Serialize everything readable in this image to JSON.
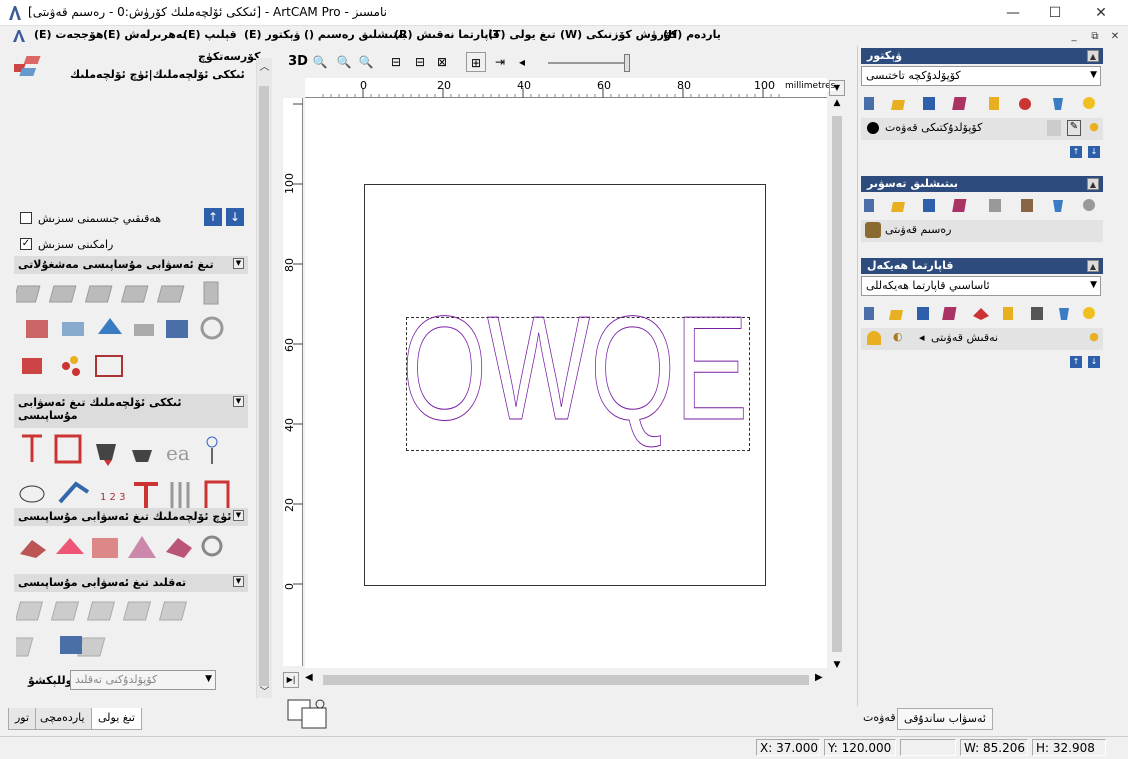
{
  "window": {
    "title": "[ﺋﯩﻜﻜﻰ ﺋﯚﻟﭽﻪﻣﻠﯩﻚ ﻛﯚﺭﯛﺵ:0 - ﺭﻩﺳﯩﻢ ﻗﻪﯞﯨﺘﻰ] - ArtCAM Pro - ﻧﺎﻣﺴﯩﺰ",
    "minimize": "—",
    "maximize": "☐",
    "close": "✕"
  },
  "menu": {
    "items": [
      "(H) ﻳﺎﺭﺩﻩﻡ",
      "(W) ﻛﯚﺭﯛﺵ ﻛﯚﺯﻧﯩﻜﻰ",
      "(T) ﺗﯩﻎ ﻳﻮﻟﻰ",
      "(R) ﻗﺎﭘﺎﺭﺗﻤﺎ ﻧﻪﻗﯩﺶ",
      "() ﺑﯩﺘﯩﺸﻠﯩﻖ ﺭﻩﺳﯩﻢ",
      "(E) ﯞﯦﻜﺘﻮﺭ",
      "(E) ﻗﯧﻠﯩﭗ",
      "(E) ﺗﻪﮬﺮﯨﺮﻟﻪﺵ",
      "(E) ﮬﯚﺟﺠﻪﺕ"
    ],
    "mdi": [
      "_",
      "⧉",
      "✕"
    ]
  },
  "left": {
    "header_title": "ﻛﯚﺭﺳﻪﺗﻜﯜﭺ",
    "header_sub": "ﺋﯩﻜﻜﻰ ﺋﯚﻟﭽﻪﻣﻠﯩﻚ|ﺋﯜﭺ ﺋﯚﻟﭽﻪﻣﻠﯩﻚ",
    "check1_label": "ﮬﻪﻗﯩﻘﯩﻲ ﺟﯩﺴﯩﻤﻨﻰ ﺳﯩﺰﯨﺶ",
    "check2_label": "ﺭﺍﻣﻜﯩﻨﻰ ﺳﯩﺰﯨﺶ",
    "sections": [
      "ﺗﯩﻎ ﺋﻪﺳﯟﺍﺑﻰ ﻣﯘﺳﺎﭘﯩﺴﻰ ﻣﻪﺷﻐﯘﻻﺗﻰ",
      "ﺋﯩﻜﻜﻰ ﺋﯚﻟﭽﻪﻣﻠﯩﻚ ﺗﯩﻎ ﺋﻪﺳﯟﺍﺑﻰ ﻣﯘﺳﺎﭘﯩﺴﻰ",
      "ﺋﯜﭺ ﺋﯚﻟﭽﻪﻣﻠﯩﻚ ﺗﯩﻎ ﺋﻪﺳﯟﺍﺑﻰ ﻣﯘﺳﺎﭘﯩﺴﻰ",
      "ﺗﻪﻗﻠﯩﺪ ﺗﯩﻎ ﺋﻪﺳﯟﺍﺑﻰ ﻣﯘﺳﺎﭘﯩﺴﻰ"
    ],
    "collection_label": "ﻛﻮﻟﻠﯧﻜﺸﯘ",
    "collection_value": "ﻛﯚﭘﯚﻟﺪﯗﻛﻨﻰ ﺗﻪﻗﻠﯩﺪ",
    "tabs": [
      "ﺗﯩﻎ ﻳﻮﻟﻰ",
      "ﻳﺎﺭﺩﻩﻣﭽﻰ",
      "ﺗﻮﺭ"
    ]
  },
  "view": {
    "btn3d": "3D",
    "ruler_unit": "millimetres",
    "ruler_h": [
      "0",
      "20",
      "40",
      "60",
      "80",
      "100"
    ],
    "ruler_v": [
      "100",
      "80",
      "60",
      "40",
      "20",
      "0"
    ],
    "text_vector": "OWQE"
  },
  "right": {
    "vector_title": "ﯞﯦﻜﺘﻮﺭ",
    "vector_dropdown": "ﻛﯚﭘﯚﻟﺪﯗﻛﭽﻪ ﺗﺎﺧﺘﯩﺴﻰ",
    "vector_layer": "ﻛﯚﭘﯚﻟﺪﯗﻛﺘﯩﻜﻰ ﻗﻪﯞﻩﺕ",
    "bitmap_title": "ﺑﯩﺘﯩﺸﻠﯩﻖ ﺗﻪﺳﯟﯨﺮ",
    "bitmap_layer": "ﺭﻩﺳﯩﻢ ﻗﻪﯞﯨﺘﻰ",
    "relief_title": "ﻗﺎﭘﺎﺭﺗﻤﺎ ﮬﻪﻳﻜﻪﻝ",
    "relief_dropdown": "ﺋﺎﺳﺎﺳﯩﻲ ﻗﺎﭘﺎﺭﺗﻤﺎ ﮬﻪﻳﻜﻪﻟﻠﻰ",
    "relief_layer": "ﻧﻪﻗﯩﺶ ﻗﻪﯞﯨﺘﻰ",
    "tabs": [
      "ﺋﻪﺳﯟﺍﺏ ﺳﺎﻧﺪﯗﻗﻰ",
      "ﻗﻪﯞﻩﺕ"
    ]
  },
  "status": {
    "x": "X: 37.000",
    "y": "Y: 120.000",
    "w": "W: 85.206",
    "h": "H: 32.908"
  },
  "colors": {
    "panel_header": "#2d4b7c",
    "vector_line": "#7a1fa2"
  }
}
